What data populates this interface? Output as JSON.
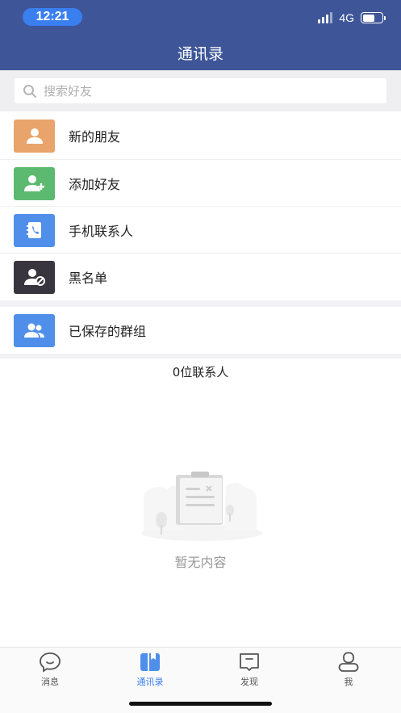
{
  "status_bar": {
    "time": "12:21",
    "network": "4G",
    "battery_level": 0.65
  },
  "header": {
    "title": "通讯录"
  },
  "search": {
    "placeholder": "搜索好友"
  },
  "menu": [
    {
      "label": "新的朋友",
      "icon": "person-icon",
      "color": "#e8a46a"
    },
    {
      "label": "添加好友",
      "icon": "add-person-icon",
      "color": "#5bba6f"
    },
    {
      "label": "手机联系人",
      "icon": "phone-book-icon",
      "color": "#4f8fea"
    },
    {
      "label": "黑名单",
      "icon": "blocked-person-icon",
      "color": "#39353e"
    }
  ],
  "groups": {
    "label": "已保存的群组",
    "icon": "group-icon",
    "color": "#4f8fea"
  },
  "contacts_count": "0位联系人",
  "empty_state": {
    "text": "暂无内容",
    "icon": "empty-clipboard-icon"
  },
  "tabs": [
    {
      "label": "消息",
      "icon": "chat-bubble-icon",
      "active": false
    },
    {
      "label": "通讯录",
      "icon": "contacts-book-icon",
      "active": true
    },
    {
      "label": "发现",
      "icon": "discover-icon",
      "active": false
    },
    {
      "label": "我",
      "icon": "profile-icon",
      "active": false
    }
  ],
  "colors": {
    "header_bg": "#3e5598",
    "accent": "#3a7ff0"
  }
}
